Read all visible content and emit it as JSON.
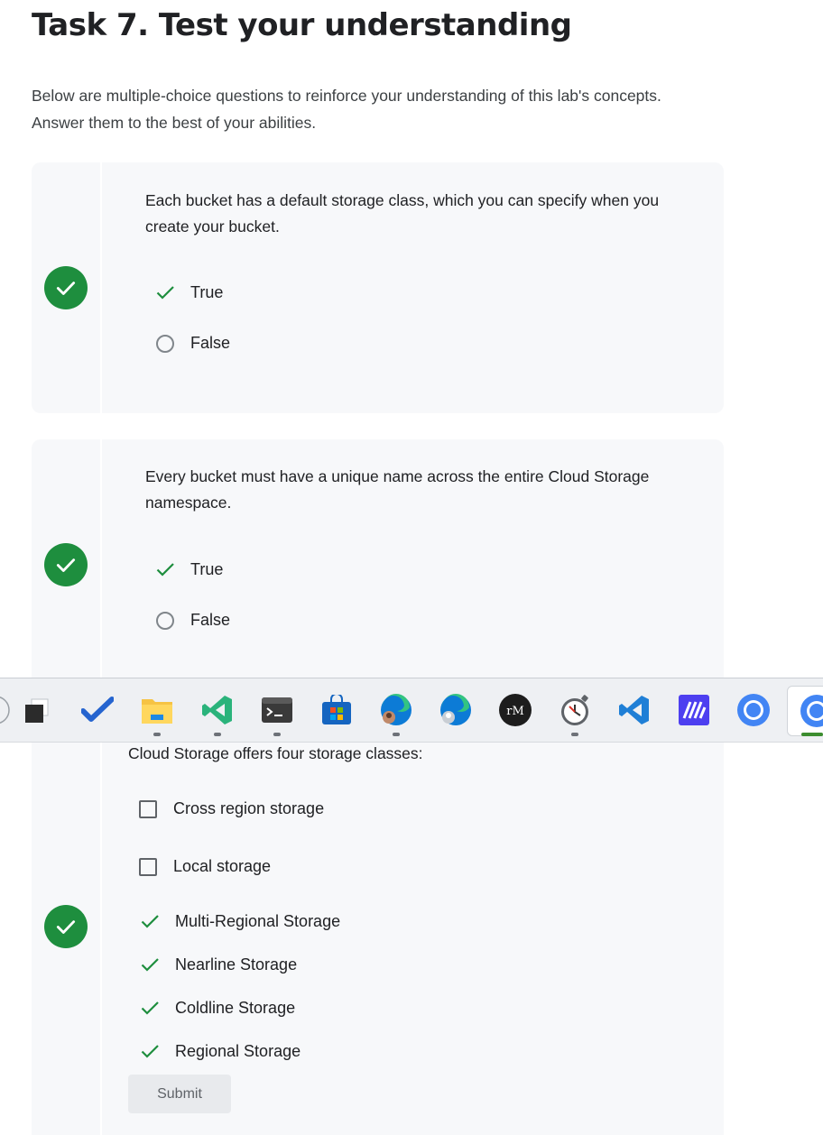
{
  "page": {
    "title": "Task 7. Test your understanding",
    "intro": "Below are multiple-choice questions to reinforce your understanding of this lab's concepts. Answer them to the best of your abilities."
  },
  "questions": [
    {
      "text": "Each bucket has a default storage class, which you can specify when you create your bucket.",
      "status": "correct",
      "options": [
        {
          "label": "True",
          "state": "checked"
        },
        {
          "label": "False",
          "state": "unselected"
        }
      ]
    },
    {
      "text": "Every bucket must have a unique name across the entire Cloud Storage namespace.",
      "status": "correct",
      "options": [
        {
          "label": "True",
          "state": "checked"
        },
        {
          "label": "False",
          "state": "unselected"
        }
      ]
    },
    {
      "text": "Cloud Storage offers four storage classes:",
      "status": "correct",
      "options": [
        {
          "label": "Cross region storage",
          "state": "unchecked"
        },
        {
          "label": "Local storage",
          "state": "unchecked"
        },
        {
          "label": "Multi-Regional Storage",
          "state": "checked"
        },
        {
          "label": "Nearline Storage",
          "state": "checked"
        },
        {
          "label": "Coldline Storage",
          "state": "checked"
        },
        {
          "label": "Regional Storage",
          "state": "checked"
        }
      ],
      "submit_label": "Submit"
    }
  ],
  "taskbar": {
    "apps": [
      {
        "icon": "task-view-icon"
      },
      {
        "icon": "todo-icon"
      },
      {
        "icon": "file-explorer-icon",
        "running": true
      },
      {
        "icon": "visual-studio-icon",
        "running": true
      },
      {
        "icon": "terminal-icon",
        "running": true
      },
      {
        "icon": "microsoft-store-icon"
      },
      {
        "icon": "edge-profile-icon",
        "running": true
      },
      {
        "icon": "edge-icon"
      },
      {
        "icon": "remember-the-milk-icon",
        "text": "rM"
      },
      {
        "icon": "alarm-clock-icon",
        "running": true
      },
      {
        "icon": "vscode-icon"
      },
      {
        "icon": "meta-app-icon"
      },
      {
        "icon": "chrome-icon"
      },
      {
        "icon": "chrome-active-icon",
        "active": true
      }
    ]
  },
  "colors": {
    "success": "#1e8e3e",
    "card_bg": "#f7f8fa",
    "text": "#202124"
  }
}
